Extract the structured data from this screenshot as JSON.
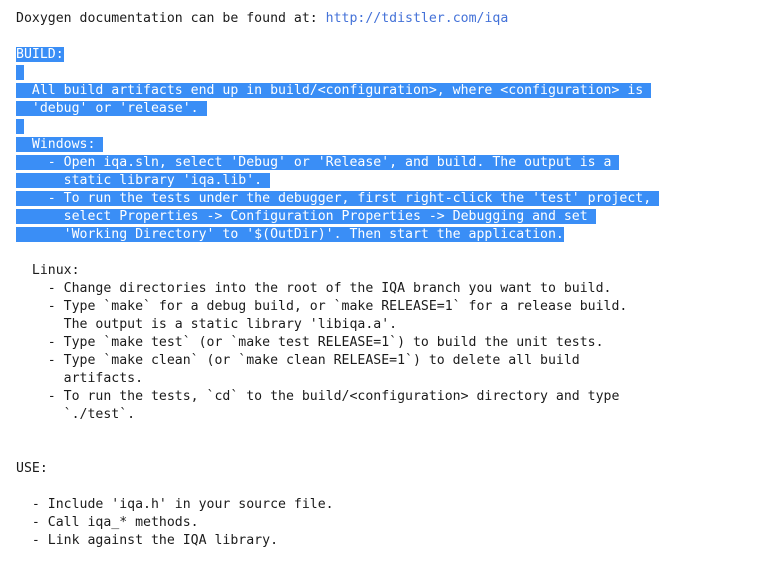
{
  "document": {
    "type": "plain-text-readme",
    "selection_color": "#3a8ef6",
    "selection_text_color": "#ffffff",
    "link_color": "#4472d8",
    "text_color": "#1b1b1b",
    "background_color": "#ffffff"
  },
  "lines": {
    "doxygen_prefix": "Doxygen documentation can be found at: ",
    "doxygen_url": "http://tdistler.com/iqa",
    "blank": "",
    "build_heading": "BUILD:",
    "build_para_1": "  All build artifacts end up in build/<configuration>, where <configuration> is ",
    "build_para_2": "  'debug' or 'release'. ",
    "windows_heading": "  Windows: ",
    "windows_1a": "    - Open iqa.sln, select 'Debug' or 'Release', and build. The output is a ",
    "windows_1b": "      static library 'iqa.lib'. ",
    "windows_2a": "    - To run the tests under the debugger, first right-click the 'test' project, ",
    "windows_2b": "      select Properties -> Configuration Properties -> Debugging and set ",
    "windows_2c": "      'Working Directory' to '$(OutDir)'. Then start the application.",
    "linux_heading": "  Linux:",
    "linux_1": "    - Change directories into the root of the IQA branch you want to build.",
    "linux_2a": "    - Type `make` for a debug build, or `make RELEASE=1` for a release build.",
    "linux_2b": "      The output is a static library 'libiqa.a'.",
    "linux_3": "    - Type `make test` (or `make test RELEASE=1`) to build the unit tests.",
    "linux_4a": "    - Type `make clean` (or `make clean RELEASE=1`) to delete all build",
    "linux_4b": "      artifacts.",
    "linux_5a": "    - To run the tests, `cd` to the build/<configuration> directory and type",
    "linux_5b": "      `./test`.",
    "use_heading": "USE:",
    "use_1": "  - Include 'iqa.h' in your source file.",
    "use_2": "  - Call iqa_* methods.",
    "use_3": "  - Link against the IQA library."
  }
}
